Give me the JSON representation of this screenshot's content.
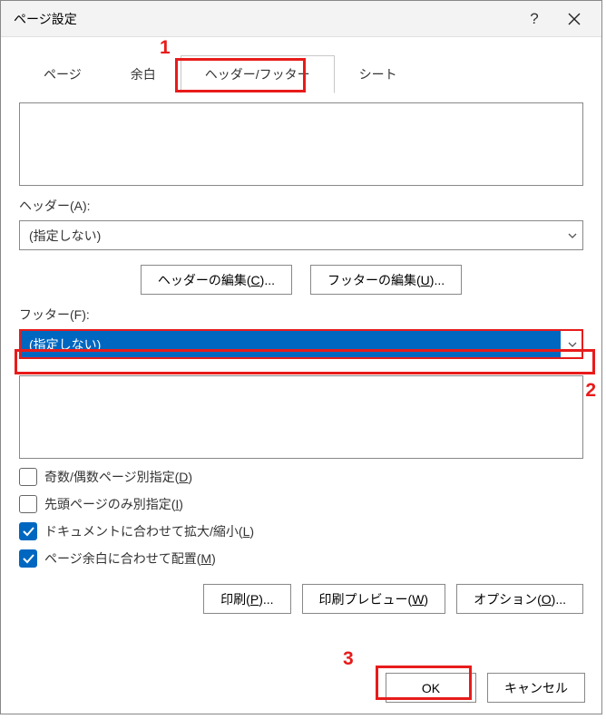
{
  "dialog": {
    "title": "ページ設定"
  },
  "tabs": {
    "page": "ページ",
    "margins": "余白",
    "headerFooter": "ヘッダー/フッター",
    "sheet": "シート"
  },
  "header": {
    "label": "ヘッダー(A):",
    "selected": "(指定しない)"
  },
  "buttons": {
    "editHeader_pre": "ヘッダーの編集(",
    "editHeader_key": "C",
    "editHeader_post": ")...",
    "editFooter_pre": "フッターの編集(",
    "editFooter_key": "U",
    "editFooter_post": ")...",
    "print_pre": "印刷(",
    "print_key": "P",
    "print_post": ")...",
    "preview_pre": "印刷プレビュー(",
    "preview_key": "W",
    "preview_post": ")",
    "options_pre": "オプション(",
    "options_key": "O",
    "options_post": ")...",
    "ok": "OK",
    "cancel": "キャンセル"
  },
  "footer": {
    "label": "フッター(F):",
    "selected": "(指定しない)"
  },
  "checkboxes": {
    "oddEven_pre": "奇数/偶数ページ別指定(",
    "oddEven_key": "D",
    "oddEven_post": ")",
    "firstPage_pre": "先頭ページのみ別指定(",
    "firstPage_key": "I",
    "firstPage_post": ")",
    "scaleDoc_pre": "ドキュメントに合わせて拡大/縮小(",
    "scaleDoc_key": "L",
    "scaleDoc_post": ")",
    "alignMargins_pre": "ページ余白に合わせて配置(",
    "alignMargins_key": "M",
    "alignMargins_post": ")",
    "oddEven_on": false,
    "firstPage_on": false,
    "scaleDoc_on": true,
    "alignMargins_on": true
  },
  "annotations": {
    "n1": "1",
    "n2": "2",
    "n3": "3"
  }
}
